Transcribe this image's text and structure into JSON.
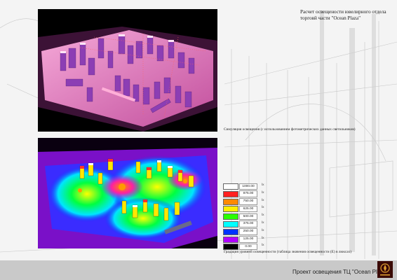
{
  "title": {
    "line1": "Расчет освещености ювелирного отдела",
    "line2": "торговй части \"Ocean Plaza\""
  },
  "caption_simulation": "Симуляция освещения (с использованием фотометрических данных светильников)",
  "caption_gradation": "Градация уровней освещенности (таблица значения освещенности (Е) в люксах)",
  "legend": {
    "unit": "lx",
    "rows": [
      {
        "value": "1000.00",
        "color": "#ffffff"
      },
      {
        "value": "875.00",
        "color": "#ff2020"
      },
      {
        "value": "750.00",
        "color": "#ff8a00"
      },
      {
        "value": "625.00",
        "color": "#ffee00"
      },
      {
        "value": "500.00",
        "color": "#2aff00"
      },
      {
        "value": "375.00",
        "color": "#00ffff"
      },
      {
        "value": "250.00",
        "color": "#0033ff"
      },
      {
        "value": "125.00",
        "color": "#b000ff"
      },
      {
        "value": "0.00",
        "color": "#000000"
      }
    ]
  },
  "footer": {
    "text": "Проект освещения ТЦ \"Ocean Plaza\""
  }
}
